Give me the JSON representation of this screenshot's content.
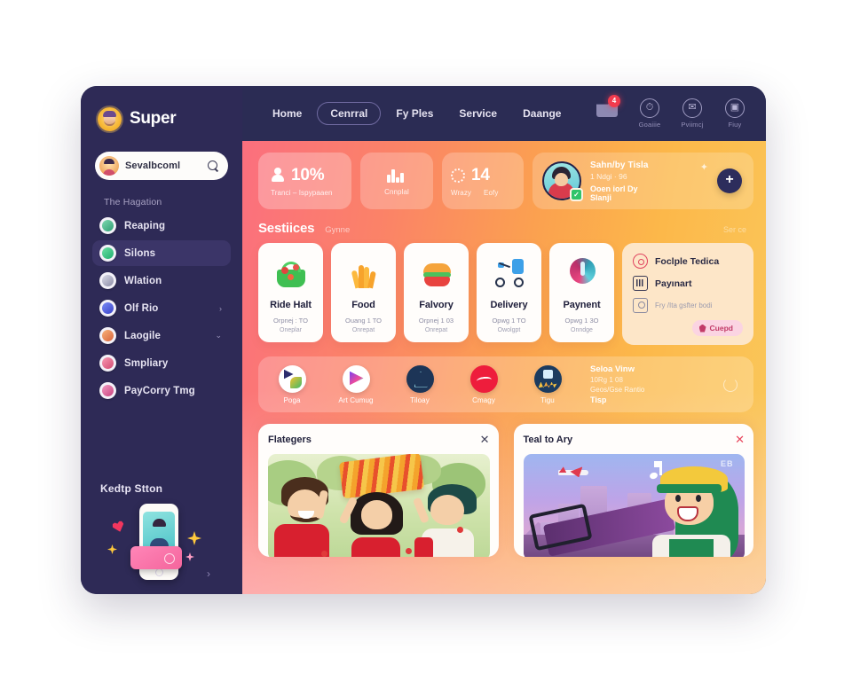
{
  "brand": {
    "name": "Super",
    "logo_icon": "sunflower-avatar-icon"
  },
  "sidebar": {
    "search": {
      "value": "Sevalbcoml",
      "icon": "search-icon",
      "avatar_icon": "user-avatar-icon"
    },
    "nav_label": "The Hagation",
    "items": [
      {
        "label": "Reaping",
        "icon": "leaf-circle-icon",
        "color": "#3fb98a",
        "active": false,
        "chevron": ""
      },
      {
        "label": "Silons",
        "icon": "leaf-green-icon",
        "color": "#2fc27f",
        "active": true,
        "chevron": ""
      },
      {
        "label": "Wlation",
        "icon": "swirl-icon",
        "color": "#4a4a6a",
        "active": false,
        "chevron": ""
      },
      {
        "label": "Olf Rio",
        "icon": "user-badge-icon",
        "color": "#5b6df0",
        "active": false,
        "chevron": "›"
      },
      {
        "label": "Laogile",
        "icon": "people-icon",
        "color": "#f08a4b",
        "active": false,
        "chevron": "⌄"
      },
      {
        "label": "Smpliary",
        "icon": "person-card-icon",
        "color": "#e85a7a",
        "active": false,
        "chevron": ""
      },
      {
        "label": "PayCorry Tmg",
        "icon": "person-pay-icon",
        "color": "#e05a8a",
        "active": false,
        "chevron": ""
      }
    ],
    "promo": {
      "title": "Kedtp Stton",
      "art_icon": "phone-card-illustration",
      "chevron": "›"
    }
  },
  "topbar": {
    "tabs": [
      {
        "label": "Home",
        "active": false
      },
      {
        "label": "Cenrral",
        "active": true
      },
      {
        "label": "Fy Ples",
        "active": false
      },
      {
        "label": "Service",
        "active": false
      },
      {
        "label": "Daange",
        "active": false
      }
    ],
    "icons": [
      {
        "name": "cart-icon",
        "label": "",
        "badge": "4"
      },
      {
        "name": "clock-icon",
        "label": "Goaiiie",
        "glyph": "ⓚ"
      },
      {
        "name": "message-icon",
        "label": "Pviimcj",
        "glyph": "✉"
      },
      {
        "name": "tag-icon",
        "label": "Fiuy",
        "glyph": "▣"
      }
    ]
  },
  "stats": [
    {
      "id": "percent",
      "icon": "person-icon",
      "value": "10%",
      "sub": "Tranci – Ispypaaen"
    },
    {
      "id": "chart",
      "icon": "bar-chart-icon",
      "value": "",
      "sub": "Cnnplal"
    },
    {
      "id": "count",
      "icon": "clock-dotted-icon",
      "value": "14",
      "sub_left": "Wrazy",
      "sub_right": "Eofy"
    }
  ],
  "profile": {
    "avatar_icon": "boy-avatar-icon",
    "verified_icon": "verified-check-icon",
    "line1": "Sahn/by Tisla",
    "line2": "1 Ndgi · 96",
    "line3": "Ooen iorl Dy",
    "line4": "Slanji",
    "spark_icon": "sparkle-icon",
    "add_label": "+"
  },
  "services_section": {
    "title": "Sestiices",
    "subtitle": "Gynne",
    "link": "Ser ce",
    "cards": [
      {
        "name": "Ride Halt",
        "icon": "grocery-basket-icon",
        "line1": "Orpnej : TO",
        "line2": "Oneplar"
      },
      {
        "name": "Food",
        "icon": "fries-icon",
        "line1": "Ouang 1 TO",
        "line2": "Onrepat"
      },
      {
        "name": "Falvory",
        "icon": "burger-icon",
        "line1": "Orpnej 1 03",
        "line2": "Onrepat"
      },
      {
        "name": "Delivery",
        "icon": "scooter-icon",
        "line1": "Opwg 1 TO",
        "line2": "Owolgpt"
      },
      {
        "name": "Paynent",
        "icon": "payment-circle-icon",
        "line1": "Opwg 1 3O",
        "line2": "Onndge"
      }
    ],
    "panel": {
      "rows": [
        {
          "icon": "target-circle-icon",
          "text": "Foclple Tedica",
          "muted": false
        },
        {
          "icon": "keyboard-icon",
          "text": "Payınart",
          "muted": false
        },
        {
          "icon": "contact-icon",
          "text": "Fry /Ita gsfter bodi",
          "muted": true
        }
      ],
      "button": {
        "label": "Cuepd",
        "icon": "diamond-icon"
      }
    }
  },
  "categories": {
    "items": [
      {
        "label": "Poga",
        "icon": "colorful-bird-icon"
      },
      {
        "label": "Art Cumug",
        "icon": "play-triangle-icon"
      },
      {
        "label": "Tiloay",
        "icon": "mountain-outline-icon"
      },
      {
        "label": "Cmagy",
        "icon": "wave-icon"
      },
      {
        "label": "Tigu",
        "icon": "stage-people-icon"
      }
    ],
    "info": {
      "line1": "Seloa Vinw",
      "line2": "10Rg 1 08",
      "line3": "Geos/Gse Rantio",
      "line4": "Tisp"
    },
    "refresh_icon": "refresh-icon"
  },
  "bottom_cards": [
    {
      "title": "Flategers",
      "close": "✕",
      "image_icon": "park-celebration-illustration"
    },
    {
      "title": "Teal to Ary",
      "close": "✕",
      "image_icon": "city-skateboard-illustration",
      "watermark": "EB"
    }
  ]
}
